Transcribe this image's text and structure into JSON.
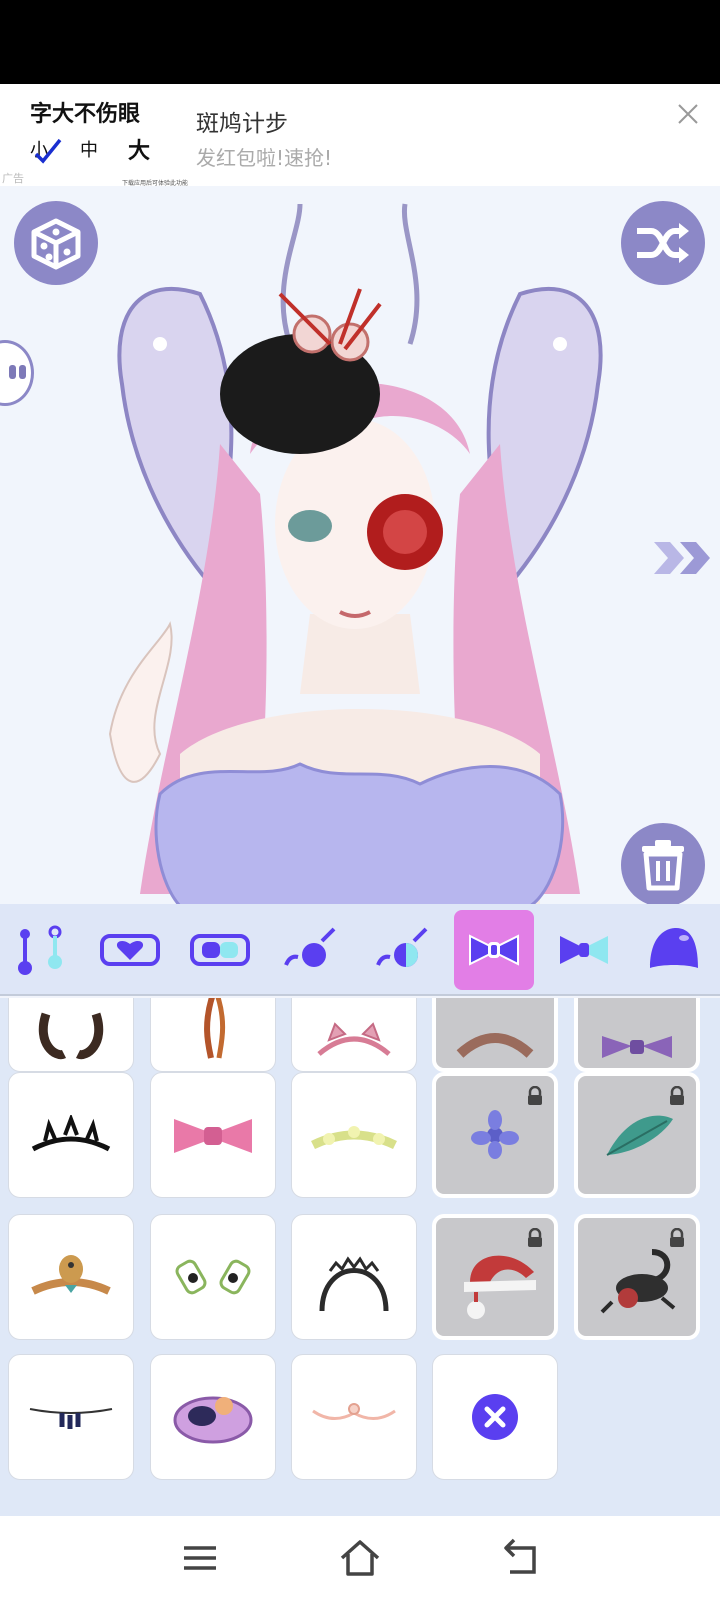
{
  "ad": {
    "title": "字大不伤眼",
    "size_small": "小",
    "size_medium": "中",
    "size_large": "大",
    "tag": "广告",
    "fine_print": "下载应用后可体验此功能",
    "app_name": "斑鸠计步",
    "description": "发红包啦!速抢!"
  },
  "toolbar": {
    "random_icon": "dice-icon",
    "shuffle_icon": "shuffle-icon",
    "delete_icon": "trash-icon",
    "next_icon": "double-chevron-right-icon"
  },
  "category_tabs": [
    {
      "icon": "accessory-pin-icon",
      "active": false
    },
    {
      "icon": "heart-frame-icon",
      "active": false
    },
    {
      "icon": "glasses-icon",
      "active": false
    },
    {
      "icon": "face-mark-icon",
      "active": false
    },
    {
      "icon": "face-paint-icon",
      "active": false
    },
    {
      "icon": "bow-icon",
      "active": true
    },
    {
      "icon": "bow-alt-icon",
      "active": false
    },
    {
      "icon": "hat-icon",
      "active": false
    }
  ],
  "items": [
    {
      "name": "horns",
      "locked": false
    },
    {
      "name": "feather-clip",
      "locked": false
    },
    {
      "name": "cat-ear-headband",
      "locked": false
    },
    {
      "name": "brown-headband",
      "locked": true
    },
    {
      "name": "purple-bow",
      "locked": true
    },
    {
      "name": "black-tiara",
      "locked": false
    },
    {
      "name": "pink-bow",
      "locked": false
    },
    {
      "name": "flower-crown",
      "locked": false
    },
    {
      "name": "blue-flower",
      "locked": true
    },
    {
      "name": "green-leaf",
      "locked": true
    },
    {
      "name": "bird-headpiece",
      "locked": false
    },
    {
      "name": "hair-clips",
      "locked": false
    },
    {
      "name": "lace-headband",
      "locked": false
    },
    {
      "name": "santa-hat",
      "locked": true
    },
    {
      "name": "scorpion-rose",
      "locked": true
    },
    {
      "name": "tassel-chain",
      "locked": false
    },
    {
      "name": "lilac-fascinator",
      "locked": false
    },
    {
      "name": "pearl-circlet",
      "locked": false
    },
    {
      "name": "remove-accessory",
      "locked": false
    }
  ],
  "colors": {
    "accent": "#8c88c7",
    "active_tab": "#e27ee6",
    "tab_icon": "#5a3ff0",
    "remove_button": "#5a3ff0"
  }
}
